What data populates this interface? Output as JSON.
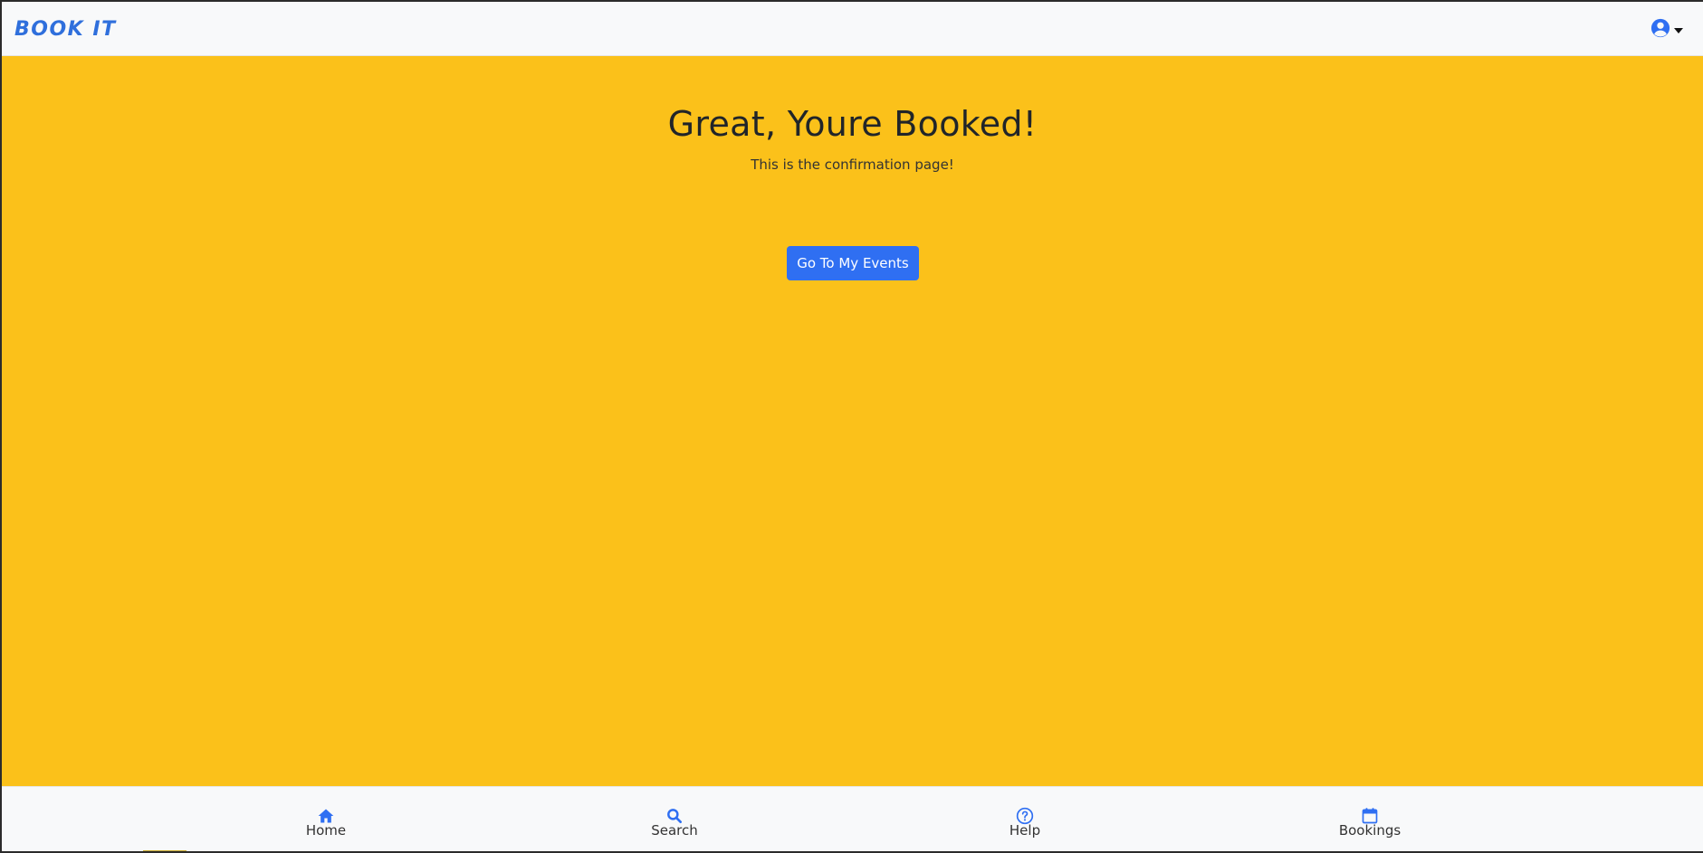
{
  "header": {
    "brand": "BOOK IT",
    "user_icon": "user-circle-icon",
    "caret_icon": "caret-down-icon"
  },
  "main": {
    "title": "Great, Youre Booked!",
    "subtitle": "This is the confirmation page!",
    "cta_label": "Go To My Events"
  },
  "bottom_nav": {
    "items": [
      {
        "label": "Home",
        "icon": "home-icon"
      },
      {
        "label": "Search",
        "icon": "search-icon"
      },
      {
        "label": "Help",
        "icon": "question-circle-icon"
      },
      {
        "label": "Bookings",
        "icon": "calendar-icon"
      }
    ]
  },
  "colors": {
    "page_background": "#fbc11a",
    "navbar_background": "#f8f9fa",
    "accent_blue": "#2f6ff2",
    "brand_blue": "#2f6fdc",
    "text_dark": "#212529"
  }
}
